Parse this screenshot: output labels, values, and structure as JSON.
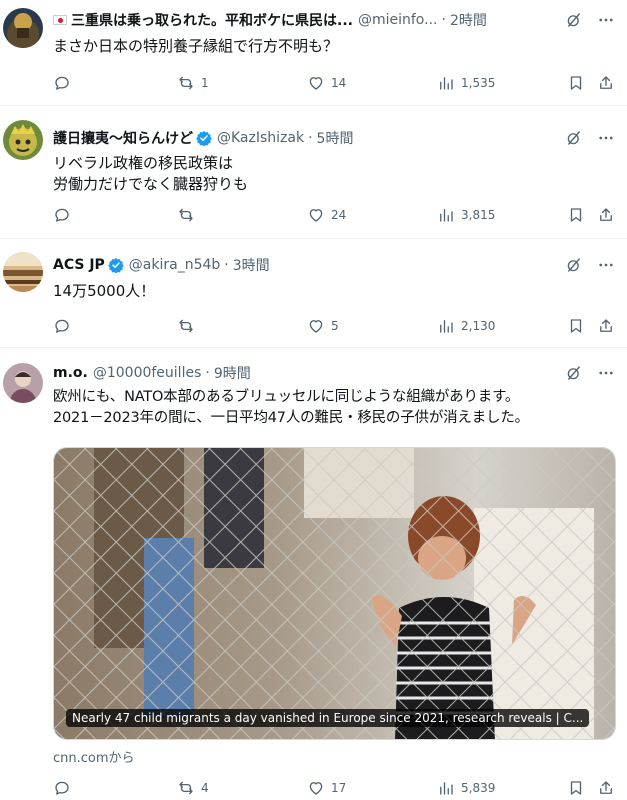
{
  "tweets": [
    {
      "name": "三重県は乗っ取られた。平和ボケに県民は...",
      "handle": "@mieinfo...",
      "time": "2時間",
      "text": "まさか日本の特別養子縁組で行方不明も？",
      "replies": "",
      "retweets": "1",
      "likes": "14",
      "views": "1,535"
    },
    {
      "name": "護日攘夷～知らんけど",
      "handle": "@KazIshizak",
      "time": "5時間",
      "text": "リベラル政権の移民政策は\n労働力だけでなく臓器狩りも",
      "replies": "",
      "retweets": "",
      "likes": "24",
      "views": "3,815"
    },
    {
      "name": "ACS JP",
      "handle": "@akira_n54b",
      "time": "3時間",
      "text": "14万5000人！",
      "replies": "",
      "retweets": "",
      "likes": "5",
      "views": "2,130"
    },
    {
      "name": "m.o.",
      "handle": "@10000feuilles",
      "time": "9時間",
      "text": "欧州にも、NATO本部のあるブリュッセルに同じような組織があります。\n2021－2023年の間に、一日平均47人の難民・移民の子供が消えました。",
      "media_caption": "Nearly 47 child migrants a day vanished in Europe since 2021, research reveals | C...",
      "source": "cnn.comから",
      "replies": "",
      "retweets": "4",
      "likes": "17",
      "views": "5,839"
    }
  ],
  "separator": "·",
  "colors": {
    "verified": "#1d9bf0",
    "secondary": "#536471",
    "primary": "#0f1419"
  }
}
